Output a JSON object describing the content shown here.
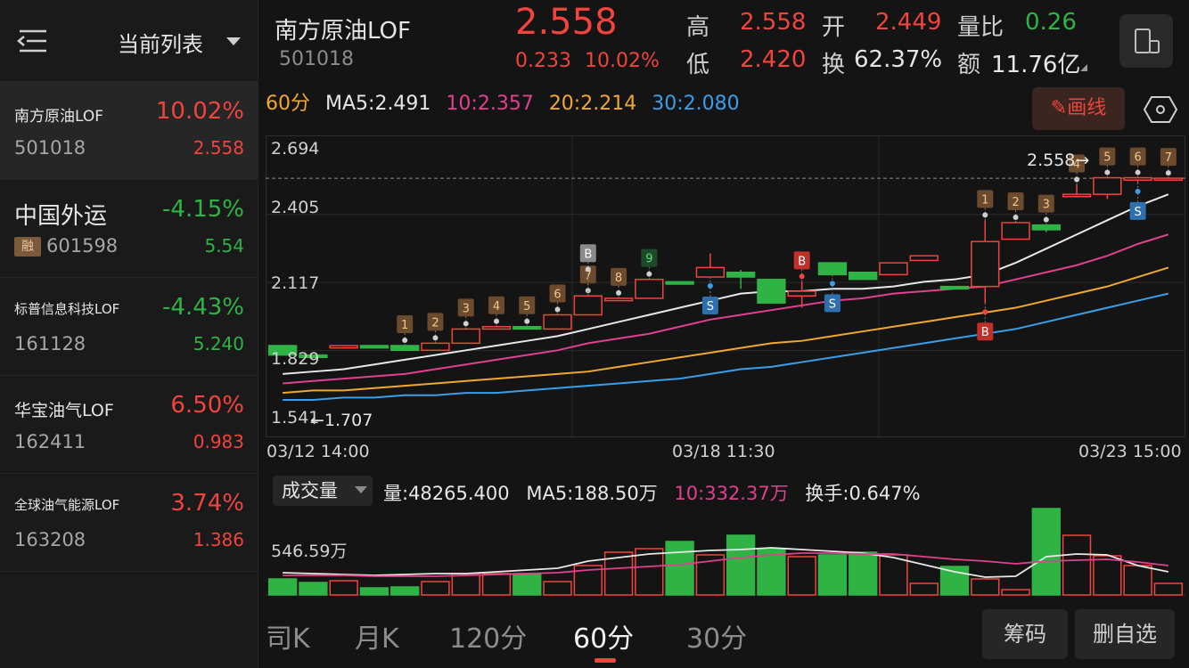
{
  "sidebar": {
    "title": "当前列表",
    "items": [
      {
        "name": "南方原油LOF",
        "change": "10.02%",
        "code": "501018",
        "price": "2.558",
        "dir": "up"
      },
      {
        "name": "中国外运",
        "change": "-4.15%",
        "code": "601598",
        "price": "5.54",
        "dir": "down",
        "badge": "融"
      },
      {
        "name": "标普信息科技LOF",
        "change": "-4.43%",
        "code": "161128",
        "price": "5.240",
        "dir": "down"
      },
      {
        "name": "华宝油气LOF",
        "change": "6.50%",
        "code": "162411",
        "price": "0.983",
        "dir": "up"
      },
      {
        "name": "全球油气能源LOF",
        "change": "3.74%",
        "code": "163208",
        "price": "1.386",
        "dir": "up"
      }
    ]
  },
  "header": {
    "name": "南方原油LOF",
    "code": "501018",
    "price": "2.558",
    "change_abs": "0.233",
    "change_pct": "10.02%",
    "quotes": {
      "high_label": "高",
      "high": "2.558",
      "open_label": "开",
      "open": "2.449",
      "vol_ratio_label": "量比",
      "vol_ratio": "0.26",
      "low_label": "低",
      "low": "2.420",
      "turnover_label": "换",
      "turnover": "62.37%",
      "amount_label": "额",
      "amount": "11.76亿"
    }
  },
  "ma_legend": {
    "period": "60分",
    "ma5": "MA5:2.491",
    "ma10": "10:2.357",
    "ma20": "20:2.214",
    "ma30": "30:2.080"
  },
  "draw_button": "画线",
  "chart_data": [
    {
      "type": "candlestick",
      "period": "60分",
      "yticks": [
        "2.694",
        "2.405",
        "2.117",
        "1.829",
        "1.541"
      ],
      "xticks": [
        "03/12 14:00",
        "03/18 11:30",
        "03/23 15:00"
      ],
      "ylim": [
        1.541,
        2.694
      ],
      "last_price_label": "2.558",
      "low_label": "1.707",
      "candles": [
        {
          "o": 1.85,
          "c": 1.81,
          "h": 1.85,
          "l": 1.81
        },
        {
          "o": 1.81,
          "c": 1.8,
          "h": 1.81,
          "l": 1.8
        },
        {
          "o": 1.84,
          "c": 1.85,
          "h": 1.85,
          "l": 1.84
        },
        {
          "o": 1.85,
          "c": 1.84,
          "h": 1.85,
          "l": 1.84
        },
        {
          "o": 1.85,
          "c": 1.83,
          "h": 1.85,
          "l": 1.83
        },
        {
          "o": 1.83,
          "c": 1.86,
          "h": 1.86,
          "l": 1.83
        },
        {
          "o": 1.86,
          "c": 1.92,
          "h": 1.92,
          "l": 1.86
        },
        {
          "o": 1.92,
          "c": 1.93,
          "h": 1.93,
          "l": 1.92
        },
        {
          "o": 1.93,
          "c": 1.92,
          "h": 1.93,
          "l": 1.92
        },
        {
          "o": 1.92,
          "c": 1.98,
          "h": 1.98,
          "l": 1.92
        },
        {
          "o": 1.98,
          "c": 2.06,
          "h": 2.06,
          "l": 1.98
        },
        {
          "o": 2.04,
          "c": 2.05,
          "h": 2.05,
          "l": 2.04
        },
        {
          "o": 2.05,
          "c": 2.13,
          "h": 2.13,
          "l": 2.05
        },
        {
          "o": 2.12,
          "c": 2.11,
          "h": 2.12,
          "l": 2.11
        },
        {
          "o": 2.14,
          "c": 2.18,
          "h": 2.24,
          "l": 2.14
        },
        {
          "o": 2.16,
          "c": 2.14,
          "h": 2.17,
          "l": 2.09
        },
        {
          "o": 2.13,
          "c": 2.03,
          "h": 2.13,
          "l": 2.03
        },
        {
          "o": 2.06,
          "c": 2.08,
          "h": 2.12,
          "l": 2.01
        },
        {
          "o": 2.2,
          "c": 2.15,
          "h": 2.2,
          "l": 2.15
        },
        {
          "o": 2.16,
          "c": 2.13,
          "h": 2.16,
          "l": 2.13
        },
        {
          "o": 2.15,
          "c": 2.2,
          "h": 2.2,
          "l": 2.15
        },
        {
          "o": 2.21,
          "c": 2.23,
          "h": 2.23,
          "l": 2.21
        },
        {
          "o": 2.1,
          "c": 2.09,
          "h": 2.1,
          "l": 2.09
        },
        {
          "o": 2.1,
          "c": 2.29,
          "h": 2.38,
          "l": 2.03
        },
        {
          "o": 2.3,
          "c": 2.37,
          "h": 2.37,
          "l": 2.3
        },
        {
          "o": 2.36,
          "c": 2.34,
          "h": 2.36,
          "l": 2.33
        },
        {
          "o": 2.48,
          "c": 2.49,
          "h": 2.53,
          "l": 2.48
        },
        {
          "o": 2.49,
          "c": 2.56,
          "h": 2.56,
          "l": 2.47
        },
        {
          "o": 2.55,
          "c": 2.56,
          "h": 2.56,
          "l": 2.54
        },
        {
          "o": 2.55,
          "c": 2.558,
          "h": 2.558,
          "l": 2.55
        }
      ],
      "ma": {
        "ma5": {
          "color": "#e8e8e8",
          "values": [
            1.73,
            1.74,
            1.75,
            1.77,
            1.79,
            1.81,
            1.83,
            1.85,
            1.87,
            1.89,
            1.92,
            1.95,
            1.98,
            2.01,
            2.04,
            2.07,
            2.08,
            2.08,
            2.09,
            2.09,
            2.1,
            2.12,
            2.13,
            2.15,
            2.2,
            2.26,
            2.32,
            2.38,
            2.44,
            2.49
          ]
        },
        "ma10": {
          "color": "#e0408f",
          "values": [
            1.69,
            1.7,
            1.71,
            1.72,
            1.73,
            1.75,
            1.77,
            1.79,
            1.81,
            1.83,
            1.86,
            1.88,
            1.9,
            1.93,
            1.96,
            1.98,
            2.0,
            2.02,
            2.04,
            2.05,
            2.07,
            2.08,
            2.09,
            2.1,
            2.13,
            2.16,
            2.19,
            2.23,
            2.28,
            2.32
          ]
        },
        "ma20": {
          "color": "#f0a830",
          "values": [
            1.65,
            1.66,
            1.66,
            1.67,
            1.68,
            1.69,
            1.7,
            1.71,
            1.72,
            1.73,
            1.74,
            1.76,
            1.78,
            1.8,
            1.82,
            1.84,
            1.86,
            1.87,
            1.89,
            1.91,
            1.93,
            1.95,
            1.97,
            1.99,
            2.01,
            2.04,
            2.07,
            2.1,
            2.14,
            2.18
          ]
        },
        "ma30": {
          "color": "#3a9ee8",
          "values": [
            1.62,
            1.62,
            1.63,
            1.63,
            1.64,
            1.64,
            1.65,
            1.65,
            1.66,
            1.67,
            1.68,
            1.69,
            1.7,
            1.71,
            1.73,
            1.75,
            1.76,
            1.78,
            1.8,
            1.82,
            1.84,
            1.86,
            1.88,
            1.9,
            1.92,
            1.95,
            1.98,
            2.01,
            2.04,
            2.07
          ]
        }
      },
      "markers": [
        {
          "i": 4,
          "text": "1",
          "side": "top"
        },
        {
          "i": 5,
          "text": "2",
          "side": "top"
        },
        {
          "i": 6,
          "text": "3",
          "side": "top"
        },
        {
          "i": 7,
          "text": "4",
          "side": "top"
        },
        {
          "i": 8,
          "text": "5",
          "side": "top"
        },
        {
          "i": 9,
          "text": "6",
          "side": "top"
        },
        {
          "i": 10,
          "text": "7",
          "side": "top"
        },
        {
          "i": 10,
          "text": "B",
          "side": "top2",
          "kind": "B-grey"
        },
        {
          "i": 11,
          "text": "8",
          "side": "top"
        },
        {
          "i": 12,
          "text": "9",
          "side": "top",
          "kind": "green"
        },
        {
          "i": 14,
          "text": "S",
          "side": "bottom",
          "kind": "S"
        },
        {
          "i": 17,
          "text": "B",
          "side": "top",
          "kind": "B"
        },
        {
          "i": 18,
          "text": "S",
          "side": "bottom",
          "kind": "S"
        },
        {
          "i": 23,
          "text": "1",
          "side": "top"
        },
        {
          "i": 23,
          "text": "B",
          "side": "bottom",
          "kind": "B"
        },
        {
          "i": 24,
          "text": "2",
          "side": "top"
        },
        {
          "i": 25,
          "text": "3",
          "side": "top"
        },
        {
          "i": 26,
          "text": "4",
          "side": "top"
        },
        {
          "i": 27,
          "text": "5",
          "side": "top"
        },
        {
          "i": 28,
          "text": "6",
          "side": "top"
        },
        {
          "i": 29,
          "text": "7",
          "side": "top"
        },
        {
          "i": 28,
          "text": "S",
          "side": "bottom",
          "kind": "S"
        }
      ]
    },
    {
      "type": "bar",
      "name": "成交量",
      "ytick": "546.59万",
      "ylim": [
        0,
        1000
      ],
      "volumes": [
        180,
        140,
        160,
        80,
        90,
        150,
        240,
        240,
        240,
        150,
        330,
        480,
        520,
        600,
        450,
        670,
        520,
        430,
        450,
        480,
        450,
        130,
        320,
        180,
        60,
        970,
        670,
        440,
        330,
        130
      ],
      "ma5": [
        250,
        240,
        230,
        220,
        230,
        240,
        240,
        260,
        280,
        300,
        380,
        420,
        460,
        480,
        500,
        510,
        530,
        510,
        490,
        470,
        420,
        340,
        260,
        200,
        210,
        430,
        460,
        450,
        330,
        260
      ],
      "ma10": [
        220,
        220,
        220,
        210,
        210,
        210,
        220,
        230,
        240,
        250,
        280,
        300,
        320,
        340,
        380,
        420,
        450,
        470,
        470,
        460,
        460,
        430,
        400,
        380,
        350,
        380,
        390,
        400,
        370,
        330
      ]
    }
  ],
  "volume_legend": {
    "selector": "成交量",
    "vol": "量:48265.400",
    "ma5": "MA5:188.50万",
    "ma10": "10:332.37万",
    "turnover": "换手:0.647%"
  },
  "period_tabs": [
    "司K",
    "月K",
    "120分",
    "60分",
    "30分"
  ],
  "active_tab": "60分",
  "buttons": {
    "chips": "筹码",
    "remove": "删自选"
  }
}
